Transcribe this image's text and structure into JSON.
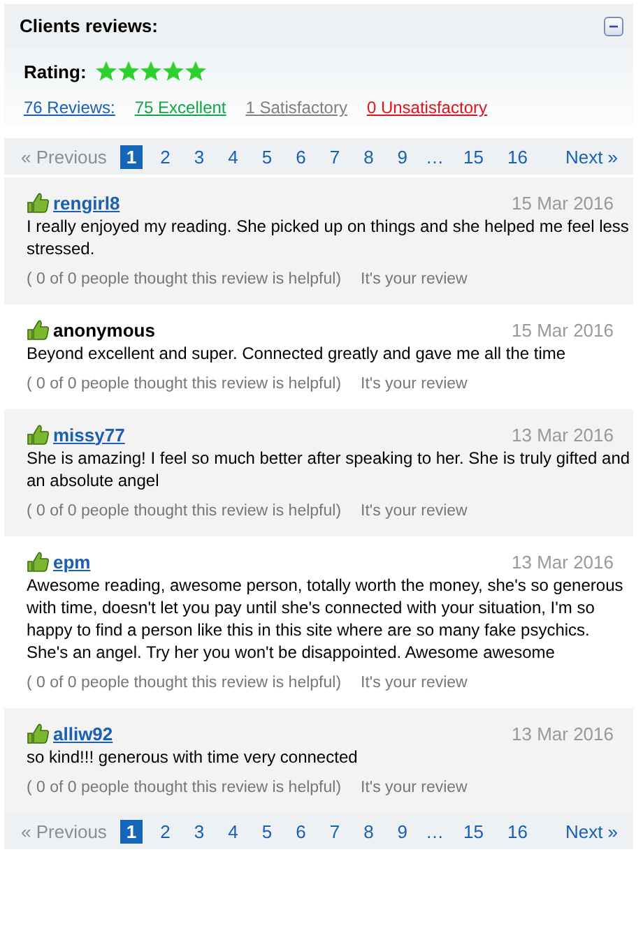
{
  "header": {
    "title": "Clients reviews:",
    "collapse_button": "−"
  },
  "rating": {
    "label": "Rating:",
    "stars": 5
  },
  "summary": [
    {
      "text": "76 Reviews:",
      "color": "#1a5fb4"
    },
    {
      "text": "75 Excellent",
      "color": "#11a544"
    },
    {
      "text": "1 Satisfactory",
      "color": "#808080"
    },
    {
      "text": "0 Unsatisfactory",
      "color": "#e8101a"
    }
  ],
  "pagination_top": {
    "previous": {
      "label": "« Previous",
      "disabled": true
    },
    "pages": [
      {
        "label": "1",
        "selected": true
      },
      {
        "label": "2",
        "selected": false
      },
      {
        "label": "3",
        "selected": false
      },
      {
        "label": "4",
        "selected": false
      },
      {
        "label": "5",
        "selected": false
      },
      {
        "label": "6",
        "selected": false
      },
      {
        "label": "7",
        "selected": false
      },
      {
        "label": "8",
        "selected": false
      },
      {
        "label": "9",
        "selected": false
      },
      {
        "label": "…",
        "kind": "gap"
      },
      {
        "label": "15",
        "selected": false
      },
      {
        "label": "16",
        "selected": false
      }
    ],
    "next": {
      "label": "Next »",
      "disabled": false
    }
  },
  "reviews": [
    {
      "author": "rengirl8",
      "author_link": true,
      "date": "15 Mar 2016",
      "text": "I really enjoyed my reading. She picked up on things and she helped me feel less stressed.",
      "helpful": "( 0 of 0 people thought this review is helpful)",
      "note": "It's your review"
    },
    {
      "author": "anonymous",
      "author_link": false,
      "date": "15 Mar 2016",
      "text": "Beyond excellent and super. Connected greatly and gave me all the time",
      "helpful": "( 0 of 0 people thought this review is helpful)",
      "note": "It's your review"
    },
    {
      "author": "missy77",
      "author_link": true,
      "date": "13 Mar 2016",
      "text": "She is amazing! I feel so much better after speaking to her. She is truly gifted and an absolute angel",
      "helpful": "( 0 of 0 people thought this review is helpful)",
      "note": "It's your review"
    },
    {
      "author": "epm",
      "author_link": true,
      "date": "13 Mar 2016",
      "text": "Awesome reading, awesome person, totally worth the money, she's so generous with time, doesn't let you pay until she's connected with your situation, I'm so happy to find a person like this in this site where are so many fake psychics. She's an angel. Try her you won't be disappointed. Awesome awesome",
      "helpful": "( 0 of 0 people thought this review is helpful)",
      "note": "It's your review"
    },
    {
      "author": "alliw92",
      "author_link": true,
      "date": "13 Mar 2016",
      "text": "so kind!!! generous with time very connected",
      "helpful": "( 0 of 0 people thought this review is helpful)",
      "note": "It's your review"
    }
  ],
  "pagination_bottom": {
    "previous": {
      "label": "« Previous",
      "disabled": true
    },
    "pages": [
      {
        "label": "1",
        "selected": true
      },
      {
        "label": "2",
        "selected": false
      },
      {
        "label": "3",
        "selected": false
      },
      {
        "label": "4",
        "selected": false
      },
      {
        "label": "5",
        "selected": false
      },
      {
        "label": "6",
        "selected": false
      },
      {
        "label": "7",
        "selected": false
      },
      {
        "label": "8",
        "selected": false
      },
      {
        "label": "9",
        "selected": false
      },
      {
        "label": "…",
        "kind": "gap"
      },
      {
        "label": "15",
        "selected": false
      },
      {
        "label": "16",
        "selected": false
      }
    ],
    "next": {
      "label": "Next »",
      "disabled": false
    }
  }
}
